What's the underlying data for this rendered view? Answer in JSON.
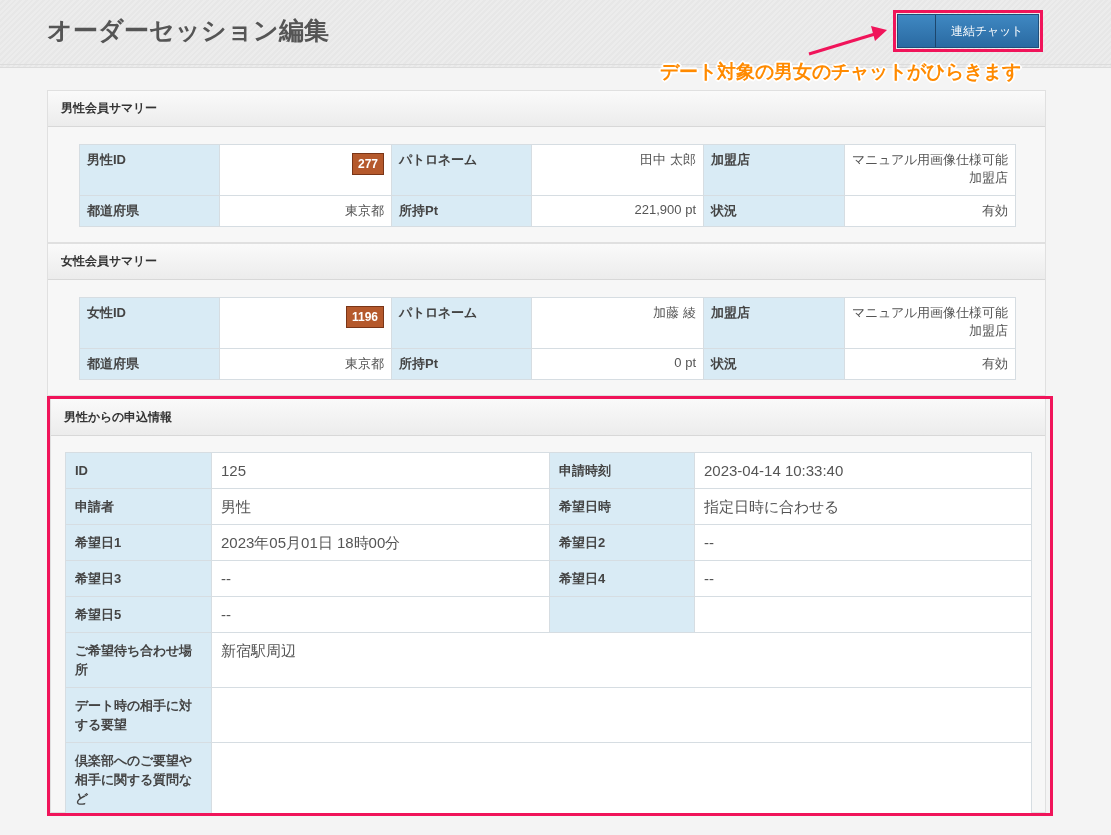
{
  "page": {
    "title": "オーダーセッション編集"
  },
  "chat_button": {
    "label": "連結チャット"
  },
  "annotation": {
    "callout": "デート対象の男女のチャットがひらきます"
  },
  "summaries": [
    {
      "title": "男性会員サマリー",
      "rows": [
        [
          {
            "label": "男性ID",
            "value": "277",
            "kind": "badge"
          },
          {
            "label": "パトロネーム",
            "value": "田中 太郎",
            "kind": "text"
          },
          {
            "label": "加盟店",
            "value": "マニュアル用画像仕様可能加盟店",
            "kind": "text"
          }
        ],
        [
          {
            "label": "都道府県",
            "value": "東京都",
            "kind": "text"
          },
          {
            "label": "所持Pt",
            "value": "221,900 pt",
            "kind": "text"
          },
          {
            "label": "状況",
            "value": "有効",
            "kind": "text"
          }
        ]
      ]
    },
    {
      "title": "女性会員サマリー",
      "rows": [
        [
          {
            "label": "女性ID",
            "value": "1196",
            "kind": "badge"
          },
          {
            "label": "パトロネーム",
            "value": "加藤 綾",
            "kind": "text"
          },
          {
            "label": "加盟店",
            "value": "マニュアル用画像仕様可能加盟店",
            "kind": "text"
          }
        ],
        [
          {
            "label": "都道府県",
            "value": "東京都",
            "kind": "text"
          },
          {
            "label": "所持Pt",
            "value": "0 pt",
            "kind": "text"
          },
          {
            "label": "状況",
            "value": "有効",
            "kind": "text"
          }
        ]
      ]
    }
  ],
  "request": {
    "title": "男性からの申込情報",
    "highlighted": true,
    "rows": [
      {
        "kind": "pair",
        "cells": [
          {
            "label": "ID",
            "value": "125"
          },
          {
            "label": "申請時刻",
            "value": "2023-04-14 10:33:40"
          }
        ]
      },
      {
        "kind": "pair",
        "cells": [
          {
            "label": "申請者",
            "value": "男性"
          },
          {
            "label": "希望日時",
            "value": "指定日時に合わせる"
          }
        ]
      },
      {
        "kind": "pair",
        "cells": [
          {
            "label": "希望日1",
            "value": "2023年05月01日 18時00分"
          },
          {
            "label": "希望日2",
            "value": "--"
          }
        ]
      },
      {
        "kind": "pair",
        "cells": [
          {
            "label": "希望日3",
            "value": "--"
          },
          {
            "label": "希望日4",
            "value": "--"
          }
        ]
      },
      {
        "kind": "pair",
        "cells": [
          {
            "label": "希望日5",
            "value": "--"
          }
        ]
      },
      {
        "kind": "wide",
        "label": "ご希望待ち合わせ場所",
        "value": "新宿駅周辺"
      },
      {
        "kind": "wide",
        "label": "デート時の相手に対する要望"
      },
      {
        "kind": "wide",
        "label": "倶楽部へのご要望や相手に関する質問など"
      }
    ]
  }
}
